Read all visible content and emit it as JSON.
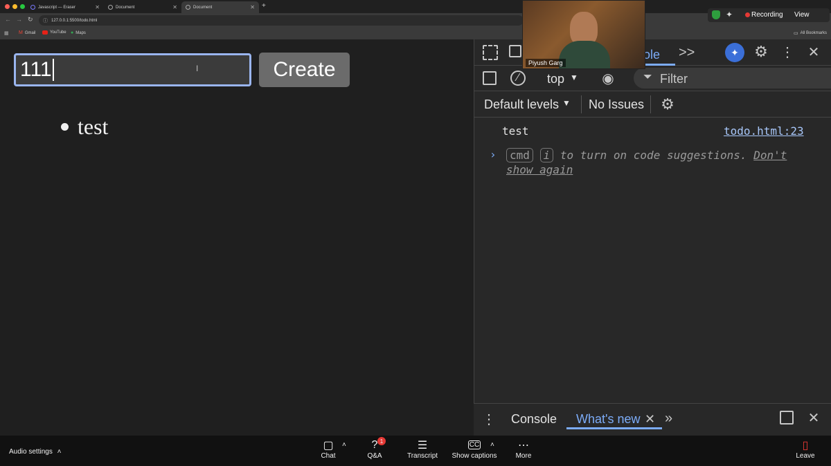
{
  "browser": {
    "tabs": [
      {
        "label": "Javascript — Eraser",
        "active": false
      },
      {
        "label": "Document",
        "active": false
      },
      {
        "label": "Document",
        "active": true
      }
    ],
    "new_tab_label": "+",
    "url": "127.0.0.1:5500/todo.html",
    "bookmarks": [
      "Gmail",
      "YouTube",
      "Maps"
    ],
    "all_bookmarks_label": "All Bookmarks"
  },
  "page": {
    "input_value": "111",
    "create_label": "Create",
    "todos": [
      "test"
    ]
  },
  "devtools": {
    "active_tab": "Console",
    "more_tabs": ">>",
    "context": "top",
    "filter_placeholder": "Filter",
    "levels": "Default levels",
    "issues": "No Issues",
    "log_message": "test",
    "log_source": "todo.html:23",
    "prompt_cmd": "cmd",
    "prompt_i": "i",
    "prompt_text": "to turn on code suggestions.",
    "prompt_link_1": "Don't",
    "prompt_link_2": "show again",
    "drawer_tab_console": "Console",
    "drawer_tab_whats_new": "What's new"
  },
  "meeting": {
    "presenter_name": "Piyush Garg",
    "recording_label": "Recording",
    "view_label": "View",
    "audio_settings": "Audio settings",
    "buttons": [
      "Chat",
      "Q&A",
      "Transcript",
      "Show captions",
      "More"
    ],
    "qa_badge": "1",
    "leave": "Leave"
  },
  "colors": {
    "accent_blue": "#7cacf8",
    "input_focus": "#9ab5ef",
    "recording_red": "#e53935"
  }
}
